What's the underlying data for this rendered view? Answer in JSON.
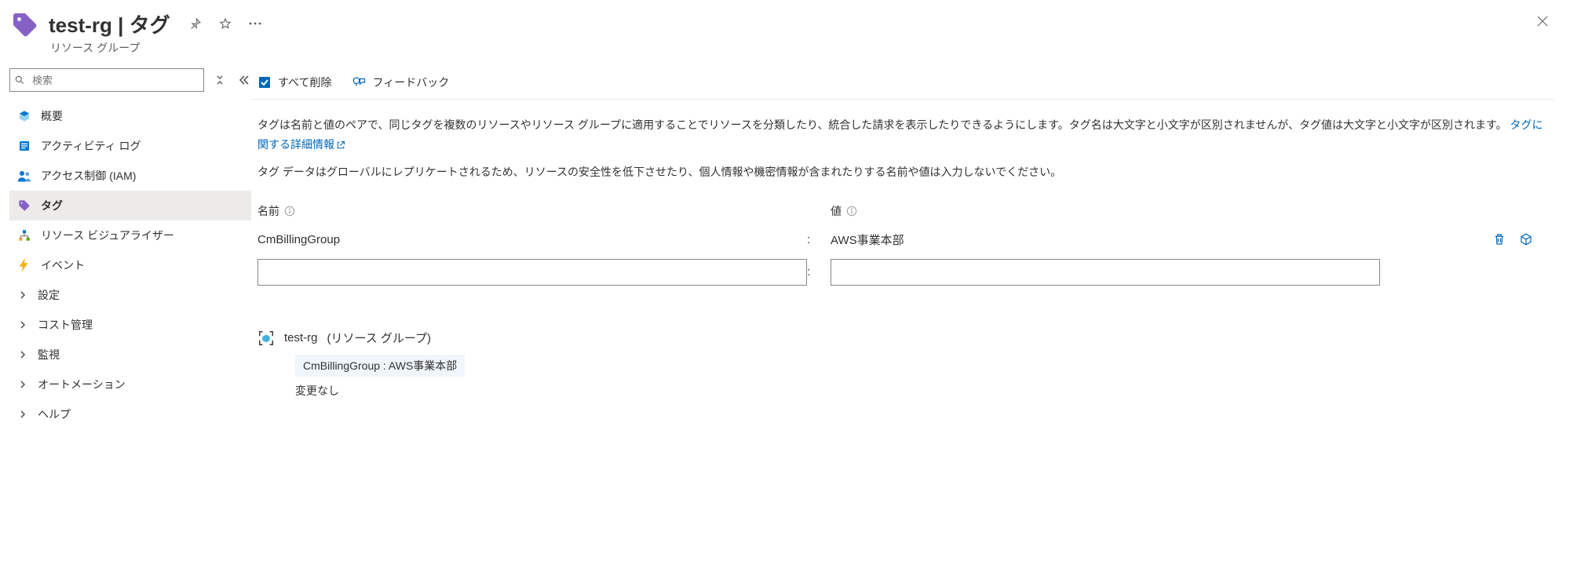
{
  "header": {
    "title": "test-rg | タグ",
    "subtitle": "リソース グループ"
  },
  "sidebar": {
    "search_placeholder": "検索",
    "items": [
      {
        "label": "概要"
      },
      {
        "label": "アクティビティ ログ"
      },
      {
        "label": "アクセス制御 (IAM)"
      },
      {
        "label": "タグ"
      },
      {
        "label": "リソース ビジュアライザー"
      },
      {
        "label": "イベント"
      }
    ],
    "groups": [
      {
        "label": "設定"
      },
      {
        "label": "コスト管理"
      },
      {
        "label": "監視"
      },
      {
        "label": "オートメーション"
      },
      {
        "label": "ヘルプ"
      }
    ]
  },
  "toolbar": {
    "delete_all": "すべて削除",
    "feedback": "フィードバック"
  },
  "desc": {
    "p1a": "タグは名前と値のペアで、同じタグを複数のリソースやリソース グループに適用することでリソースを分類したり、統合した請求を表示したりできるようにします。タグ名は大文字と小文字が区別されませんが、タグ値は大文字と小文字が区別されます。",
    "link": "タグに関する詳細情報",
    "p2": "タグ データはグローバルにレプリケートされるため、リソースの安全性を低下させたり、個人情報や機密情報が含まれたりする名前や値は入力しないでください。"
  },
  "grid": {
    "name_header": "名前",
    "value_header": "値",
    "rows": [
      {
        "name": "CmBillingGroup",
        "value": "AWS事業本部"
      }
    ]
  },
  "summary": {
    "resource_name": "test-rg",
    "resource_type": "(リソース グループ)",
    "chip": "CmBillingGroup : AWS事業本部",
    "no_change": "変更なし"
  }
}
